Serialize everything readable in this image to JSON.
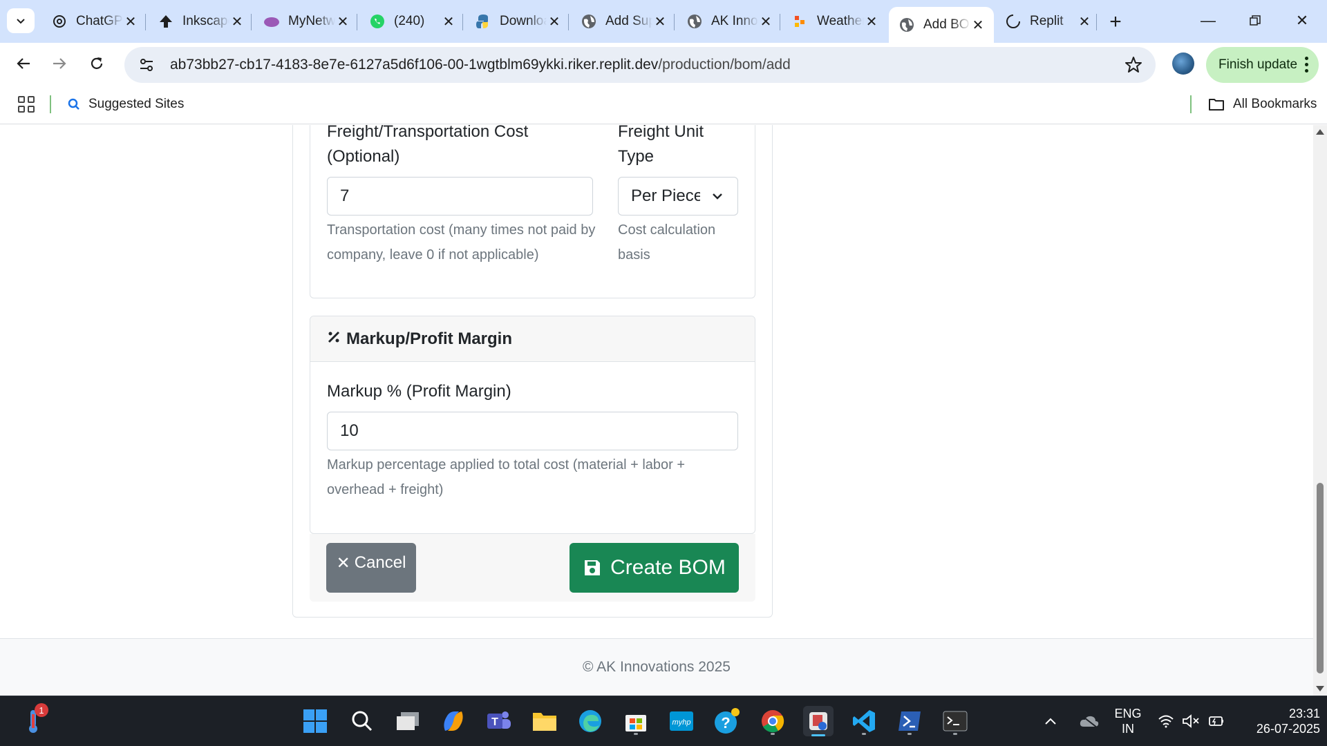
{
  "browser": {
    "tabs": [
      {
        "label": "ChatGPT",
        "icon": "openai-icon"
      },
      {
        "label": "Inkscape",
        "icon": "inkscape-icon"
      },
      {
        "label": "MyNetwork",
        "icon": "myne-icon"
      },
      {
        "label": "(240)",
        "icon": "whatsapp-icon"
      },
      {
        "label": "Downloads",
        "icon": "python-icon"
      },
      {
        "label": "Add Supplier",
        "icon": "globe-icon"
      },
      {
        "label": "AK Innovations",
        "icon": "globe-icon"
      },
      {
        "label": "Weather",
        "icon": "weather-icon"
      },
      {
        "label": "Add BOM",
        "icon": "globe-icon",
        "active": true
      },
      {
        "label": "Replit",
        "icon": "loading-icon"
      }
    ],
    "url_host": "ab73bb27-cb17-4183-8e7e-6127a5d6f106-00-1wgtblm69ykki.riker.replit.dev",
    "url_path": "/production/bom/add",
    "finish_update_label": "Finish update",
    "bookmarks": {
      "suggested_sites": "Suggested Sites",
      "all_bookmarks": "All Bookmarks"
    }
  },
  "form": {
    "freight": {
      "cost_label": "Freight/Transportation Cost (Optional)",
      "cost_value": "7",
      "cost_help": "Transportation cost (many times not paid by company, leave 0 if not applicable)",
      "unit_label": "Freight Unit Type",
      "unit_value": "Per Piece/Unit",
      "unit_help": "Cost calculation basis"
    },
    "markup": {
      "header": "Markup/Profit Margin",
      "label": "Markup % (Profit Margin)",
      "value": "10",
      "help": "Markup percentage applied to total cost (material + labor + overhead + freight)"
    },
    "cancel_label": "Cancel",
    "create_label": "Create BOM"
  },
  "footer": {
    "copyright": "© AK Innovations 2025"
  },
  "taskbar": {
    "notification_badge": "1",
    "language_line1": "ENG",
    "language_line2": "IN",
    "time": "23:31",
    "date": "26-07-2025"
  },
  "colors": {
    "accent_green": "#198754",
    "secondary_gray": "#6c757d",
    "tab_strip": "#d3e3fd"
  }
}
